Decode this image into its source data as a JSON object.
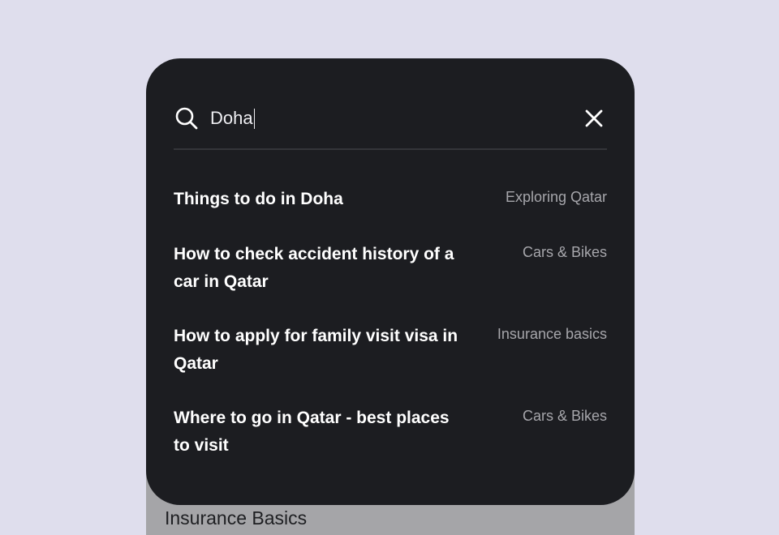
{
  "search": {
    "value": "Doha",
    "icon": "search-icon",
    "close_icon": "close-icon"
  },
  "results": [
    {
      "title": "Things to do in Doha",
      "category": "Exploring Qatar"
    },
    {
      "title": "How to check accident history of a car in Qatar",
      "category": "Cars & Bikes"
    },
    {
      "title": "How to apply for family visit visa in Qatar",
      "category": "Insurance basics"
    },
    {
      "title": "Where to go in Qatar - best places to visit",
      "category": "Cars & Bikes"
    }
  ],
  "background_section": {
    "label": "Insurance Basics"
  },
  "colors": {
    "page_background": "#dfdeed",
    "panel_background": "#1c1d21",
    "underlay": "#a5a5a8",
    "title_text": "#ffffff",
    "category_text": "#a6a6ab"
  }
}
